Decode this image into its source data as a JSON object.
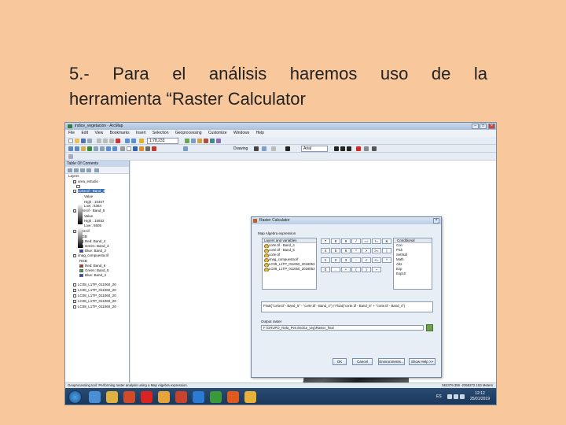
{
  "slide": {
    "title_line1": "5.- Para el análisis haremos uso de la",
    "title_line2": "herramienta “Raster Calculator"
  },
  "window": {
    "title": "indice_vegetacion - ArcMap",
    "menu": [
      "File",
      "Edit",
      "View",
      "Bookmarks",
      "Insert",
      "Selection",
      "Geoprocessing",
      "Customize",
      "Windows",
      "Help"
    ],
    "scale": "1:78,233",
    "drawing_label": "Drawing",
    "font_label": "Arial"
  },
  "toc": {
    "title": "Table Of Contents",
    "rows": [
      {
        "text": "Layers",
        "check": false,
        "swatch": null,
        "indent": 4,
        "sel": false
      },
      {
        "text": "area_estudio",
        "check": true,
        "swatch": null,
        "indent": 10,
        "sel": false
      },
      {
        "text": "",
        "check": false,
        "swatch": "#ffffff",
        "indent": 14,
        "sel": false
      },
      {
        "text": "corte.tif - Band_4",
        "check": true,
        "swatch": null,
        "indent": 10,
        "sel": true
      },
      {
        "text": "Value",
        "check": false,
        "swatch": null,
        "indent": 24,
        "sel": false
      },
      {
        "text": "High : 10457",
        "check": false,
        "swatch": null,
        "indent": 24,
        "sel": false
      },
      {
        "text": "Low : 5364",
        "check": false,
        "swatch": null,
        "indent": 24,
        "sel": false
      },
      {
        "text": "corte.tif - Band_5",
        "check": true,
        "swatch": null,
        "indent": 10,
        "sel": false
      },
      {
        "text": "Value",
        "check": false,
        "swatch": null,
        "indent": 24,
        "sel": false
      },
      {
        "text": "High : 15932",
        "check": false,
        "swatch": null,
        "indent": 24,
        "sel": false
      },
      {
        "text": "Low : 5505",
        "check": false,
        "swatch": null,
        "indent": 24,
        "sel": false
      },
      {
        "text": "corte.tif",
        "check": false,
        "swatch": null,
        "indent": 10,
        "sel": false
      },
      {
        "text": "RGB",
        "check": false,
        "swatch": null,
        "indent": 18,
        "sel": false
      },
      {
        "text": "Red: Band_4",
        "check": false,
        "swatch": "#e02020",
        "indent": 18,
        "sel": false
      },
      {
        "text": "Green: Band_3",
        "check": false,
        "swatch": "#20b020",
        "indent": 18,
        "sel": false
      },
      {
        "text": "Blue: Band_2",
        "check": false,
        "swatch": "#2040e0",
        "indent": 18,
        "sel": false
      },
      {
        "text": "imag_compuesta.tif",
        "check": false,
        "swatch": null,
        "indent": 10,
        "sel": false
      },
      {
        "text": "RGB",
        "check": false,
        "swatch": null,
        "indent": 18,
        "sel": false
      },
      {
        "text": "Red: Band_6",
        "check": false,
        "swatch": "#e02020",
        "indent": 18,
        "sel": false
      },
      {
        "text": "Green: Band_5",
        "check": false,
        "swatch": "#20b020",
        "indent": 18,
        "sel": false
      },
      {
        "text": "Blue: Band_4",
        "check": false,
        "swatch": "#2040e0",
        "indent": 18,
        "sel": false
      },
      {
        "text": "LC08_L1TP_011060_20",
        "check": false,
        "swatch": null,
        "indent": 10,
        "sel": false
      },
      {
        "text": "LC08_L1TP_011060_20",
        "check": false,
        "swatch": null,
        "indent": 10,
        "sel": false
      },
      {
        "text": "LC08_L1TP_011060_20",
        "check": false,
        "swatch": null,
        "indent": 10,
        "sel": false
      },
      {
        "text": "LC08_L1TP_011060_20",
        "check": false,
        "swatch": null,
        "indent": 10,
        "sel": false
      },
      {
        "text": "LC08_L1TP_011060_20",
        "check": false,
        "swatch": null,
        "indent": 10,
        "sel": false
      }
    ]
  },
  "dialog": {
    "title": "Raster Calculator",
    "group_label": "Map Algebra expression",
    "layers_header": "Layers and variables",
    "layers": [
      "corte.tif - Band_4",
      "corte.tif - Band_5",
      "corte.tif",
      "imag_compuesta.tif",
      "LC08_L1TP_011060_2018053",
      "LC08_L1TP_011060_2018053"
    ],
    "keys": [
      "7",
      "8",
      "9",
      "/",
      "==",
      "!=",
      "&",
      "4",
      "5",
      "6",
      "*",
      ">",
      ">=",
      "|",
      "1",
      "2",
      "3",
      "-",
      "<",
      "<=",
      "^",
      "0",
      ".",
      "+",
      "(",
      ")",
      "~"
    ],
    "conditional_header": "Conditional",
    "conditional_items": [
      "Con",
      "Pick",
      "SetNull",
      "Math",
      "Abs",
      "Exp",
      "Exp10"
    ],
    "expression": "Float(\"corte.tif - Band_5\" - \"corte.tif - Band_4\") / Float(\"corte.tif - Band_5\" + \"corte.tif - Band_4\")",
    "output_label": "Output raster",
    "output_value": "F:\\GRUPO_Rafa_Peru\\indice_veg\\Raster_final",
    "btn_ok": "OK",
    "btn_cancel": "Cancel",
    "btn_env": "Environments...",
    "btn_help": "Show Help >>"
  },
  "status": {
    "text": "Geoprocessing tool: Performing raster analysis using a Map Algebra expression.",
    "coords": "552379.359  -2355372.153 Meters"
  },
  "taskbar": {
    "time": "12:12",
    "date": "25/01/2019",
    "lang": "ES"
  },
  "colors": {
    "background": "#f8c79b",
    "taskbar": "#1f3f66",
    "selection": "#3b6fb6"
  }
}
